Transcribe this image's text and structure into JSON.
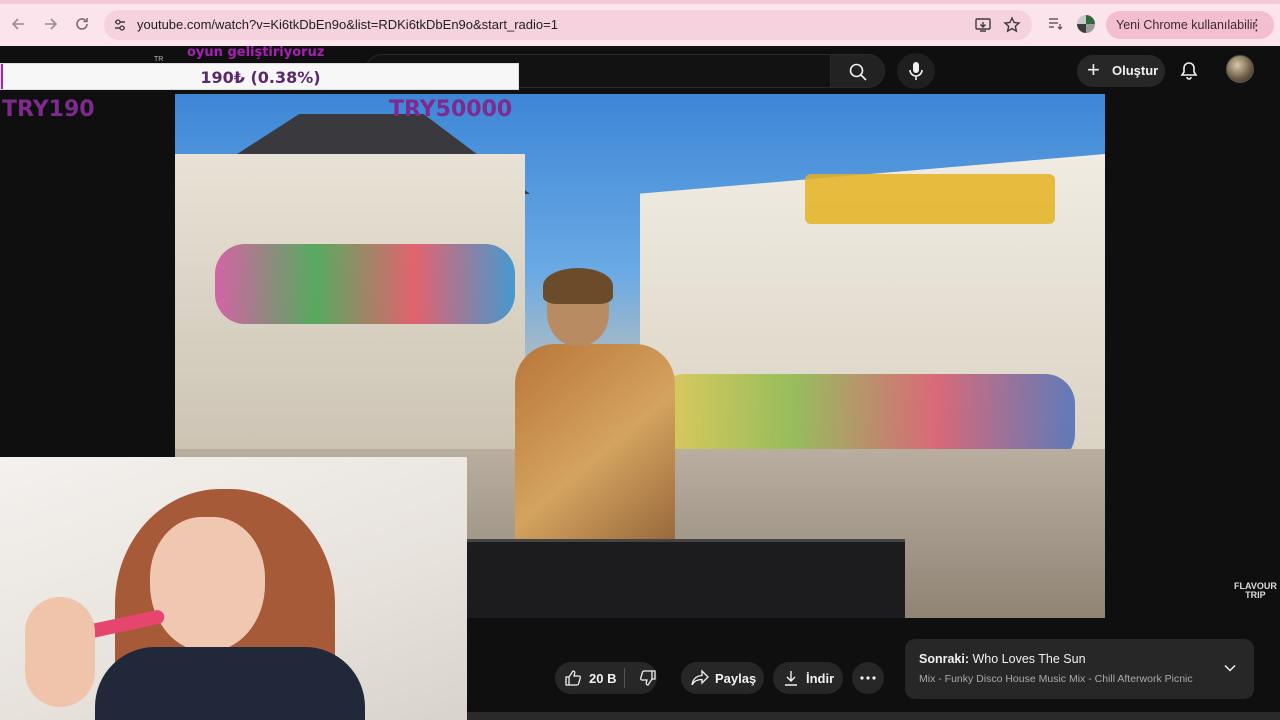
{
  "browser": {
    "url": "youtube.com/watch?v=Ki6tkDbEn9o&list=RDKi6tkDbEn9o&start_radio=1",
    "update_label": "Yeni Chrome kullanılabilir",
    "update_menu": "⋮"
  },
  "yt": {
    "create_label": "Oluştur"
  },
  "overlay": {
    "caption": "oyun geliştiriyoruz",
    "tag": "TR",
    "donation_text": "190₺ (0.38%)",
    "donation_progress_percent": 0.38,
    "goal_current": "TRY190",
    "goal_target": "TRY50000",
    "accent_color": "#9b27b0"
  },
  "video": {
    "brand_mark_line1": "FLAVOUR",
    "brand_mark_line2": "TRIP"
  },
  "actions": {
    "likes": "20 B",
    "share_label": "Paylaş",
    "download_label": "İndir"
  },
  "next_up": {
    "prefix": "Sonraki:",
    "title": "Who Loves The Sun",
    "subtitle": "Mix - Funky Disco House Music Mix - Chill Afterwork Picnic"
  },
  "icons": [
    "back-arrow-icon",
    "forward-arrow-icon",
    "reload-icon",
    "site-settings-icon",
    "install-app-icon",
    "star-icon",
    "reading-list-icon",
    "profile-icon",
    "search-icon",
    "mic-icon",
    "plus-icon",
    "bell-icon",
    "like-icon",
    "dislike-icon",
    "share-icon",
    "download-icon",
    "more-icon",
    "chevron-down-icon"
  ]
}
